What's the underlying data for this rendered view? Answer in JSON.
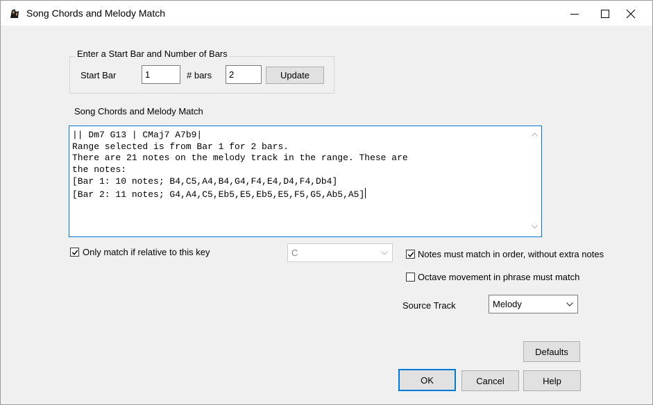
{
  "window": {
    "title": "Song Chords and Melody Match",
    "controls": [
      "minimize-icon",
      "maximize-icon",
      "close-icon"
    ]
  },
  "range_group": {
    "legend": "Enter a Start Bar and Number of Bars",
    "start_bar_label": "Start Bar",
    "start_bar_value": "1",
    "bars_label": "# bars",
    "bars_value": "2",
    "update_label": "Update"
  },
  "match_section": {
    "label": "Song Chords and Melody Match",
    "lines": [
      "|| Dm7 G13 | CMaj7 A7b9|",
      "Range selected is from Bar 1 for 2 bars.",
      "There are 21 notes on the melody track in the range. These are",
      "the notes:",
      "[Bar 1: 10 notes; B4,C5,A4,B4,G4,F4,E4,D4,F4,Db4]",
      "[Bar 2: 11 notes; G4,A4,C5,Eb5,E5,Eb5,E5,F5,G5,Ab5,A5]"
    ]
  },
  "options": {
    "relative_key_label": "Only match if relative to this  key",
    "relative_key_checked": true,
    "key_value": "C",
    "order_label": "Notes must match in order, without extra notes",
    "order_checked": true,
    "octave_label": "Octave movement in phrase must match",
    "octave_checked": false,
    "source_track_label": "Source Track",
    "source_track_value": "Melody"
  },
  "buttons": {
    "defaults": "Defaults",
    "ok": "OK",
    "cancel": "Cancel",
    "help": "Help"
  },
  "colors": {
    "accent": "#0078d7",
    "dialog_bg": "#f0f0f0",
    "button_bg": "#e1e1e1"
  }
}
